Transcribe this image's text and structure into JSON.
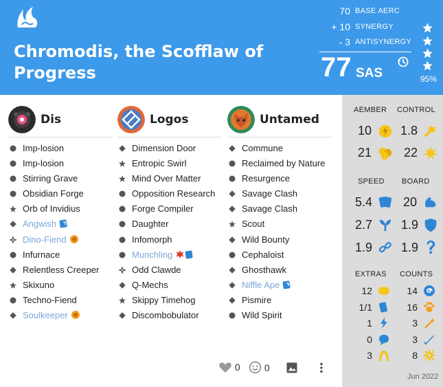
{
  "header": {
    "title": "Chromodis, the Scofflaw of Progress",
    "base_aerc_value": "70",
    "base_aerc_label": "BASE AERC",
    "synergy_value": "+ 10",
    "synergy_label": "SYNERGY",
    "antisynergy_value": "- 3",
    "antisynergy_label": "ANTISYNERGY",
    "sas_value": "77",
    "sas_label": "SAS",
    "percentile": "95%",
    "stars": 4
  },
  "houses": [
    {
      "name": "Dis",
      "cards": [
        {
          "name": "Imp-losion",
          "rarity": "common"
        },
        {
          "name": "Imp-losion",
          "rarity": "common"
        },
        {
          "name": "Stirring Grave",
          "rarity": "common"
        },
        {
          "name": "Obsidian Forge",
          "rarity": "common"
        },
        {
          "name": "Orb of Invidius",
          "rarity": "rare"
        },
        {
          "name": "Angwish",
          "rarity": "uncommon",
          "maverick": true,
          "badge": "legacy"
        },
        {
          "name": "Dino-Fiend",
          "rarity": "special",
          "maverick": true,
          "badge": "anomaly"
        },
        {
          "name": "Infurnace",
          "rarity": "common"
        },
        {
          "name": "Relentless Creeper",
          "rarity": "uncommon"
        },
        {
          "name": "Skixuno",
          "rarity": "rare"
        },
        {
          "name": "Techno-Fiend",
          "rarity": "common"
        },
        {
          "name": "Soulkeeper",
          "rarity": "uncommon",
          "maverick": true,
          "badge": "anomaly"
        }
      ]
    },
    {
      "name": "Logos",
      "cards": [
        {
          "name": "Dimension Door",
          "rarity": "uncommon"
        },
        {
          "name": "Entropic Swirl",
          "rarity": "rare"
        },
        {
          "name": "Mind Over Matter",
          "rarity": "rare"
        },
        {
          "name": "Opposition Research",
          "rarity": "common"
        },
        {
          "name": "Forge Compiler",
          "rarity": "common"
        },
        {
          "name": "Daughter",
          "rarity": "common"
        },
        {
          "name": "Infomorph",
          "rarity": "common"
        },
        {
          "name": "Munchling",
          "rarity": "common",
          "maverick": true,
          "badge": "maverick-legacy"
        },
        {
          "name": "Odd Clawde",
          "rarity": "special"
        },
        {
          "name": "Q-Mechs",
          "rarity": "uncommon"
        },
        {
          "name": "Skippy Timehog",
          "rarity": "rare"
        },
        {
          "name": "Discombobulator",
          "rarity": "uncommon"
        }
      ]
    },
    {
      "name": "Untamed",
      "cards": [
        {
          "name": "Commune",
          "rarity": "uncommon"
        },
        {
          "name": "Reclaimed by Nature",
          "rarity": "common"
        },
        {
          "name": "Resurgence",
          "rarity": "common"
        },
        {
          "name": "Savage Clash",
          "rarity": "uncommon"
        },
        {
          "name": "Savage Clash",
          "rarity": "uncommon"
        },
        {
          "name": "Scout",
          "rarity": "rare"
        },
        {
          "name": "Wild Bounty",
          "rarity": "uncommon"
        },
        {
          "name": "Cephaloist",
          "rarity": "common"
        },
        {
          "name": "Ghosthawk",
          "rarity": "uncommon"
        },
        {
          "name": "Niffle Ape",
          "rarity": "uncommon",
          "maverick": true,
          "badge": "legacy"
        },
        {
          "name": "Pismire",
          "rarity": "uncommon"
        },
        {
          "name": "Wild Spirit",
          "rarity": "common"
        }
      ]
    }
  ],
  "footer": {
    "likes": "0",
    "funny": "0"
  },
  "stats": {
    "aember_label": "AEMBER",
    "control_label": "CONTROL",
    "aember": "10",
    "control": "1.8",
    "expected_aember": "21",
    "creature_power": "22",
    "speed_label": "SPEED",
    "board_label": "BOARD",
    "speed": "5.4",
    "board": "20",
    "efficiency": "2.7",
    "recursion": "1.9",
    "disruption": "1.9",
    "creature_protection": "1.9",
    "extras_label": "EXTRAS",
    "counts_label": "COUNTS",
    "extras": [
      "12",
      "1/1",
      "1",
      "0",
      "3"
    ],
    "counts": [
      "14",
      "16",
      "3",
      "3",
      "8"
    ],
    "date": "Jun 2022"
  },
  "colors": {
    "header_bg": "#3d99e9",
    "maverick_text": "#7aa7da",
    "stats_bg": "#dcdcdc",
    "icon_yellow": "#f5c518",
    "icon_blue": "#2f86d6"
  }
}
